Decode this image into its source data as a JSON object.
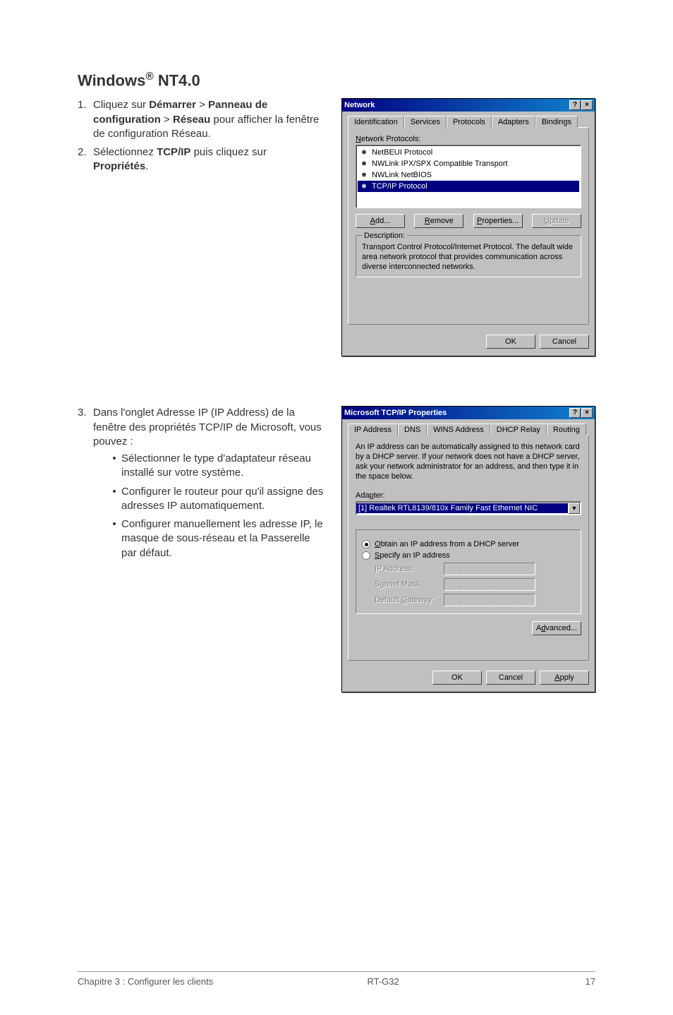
{
  "heading_plain": "Windows® NT4.0",
  "instructions_top": [
    {
      "num": "1.",
      "html": "Cliquez sur <b>Démarrer</b> > <b>Panneau de configuration</b> > <b>Réseau</b> pour afficher la fenêtre de configuration Réseau."
    },
    {
      "num": "2.",
      "html": "Sélectionnez <b>TCP/IP</b> puis cliquez sur <b>Propriétés</b>."
    }
  ],
  "instructions_bottom": [
    {
      "num": "3.",
      "html": "Dans l'onglet Adresse IP (IP Address) de la fenêtre des propriétés TCP/IP de Microsoft, vous pouvez :",
      "sub": [
        "Sélectionner le type d'adaptateur réseau installé sur votre système.",
        "Configurer le routeur pour qu'il assigne des adresses IP automatiquement.",
        "Configurer manuellement les adresse IP, le masque de sous-réseau et la Passerelle par défaut."
      ]
    }
  ],
  "dialog1": {
    "title": "Network",
    "tabs": [
      "Identification",
      "Services",
      "Protocols",
      "Adapters",
      "Bindings"
    ],
    "active_tab_index": 2,
    "list_label_html": "<span class='underline-char'>N</span>etwork Protocols:",
    "protocols": [
      {
        "label": "NetBEUI Protocol",
        "selected": false
      },
      {
        "label": "NWLink IPX/SPX Compatible Transport",
        "selected": false
      },
      {
        "label": "NWLink NetBIOS",
        "selected": false
      },
      {
        "label": "TCP/IP Protocol",
        "selected": true
      }
    ],
    "buttons": {
      "add_html": "<span class='underline-char'>A</span>dd...",
      "remove_html": "<span class='underline-char'>R</span>emove",
      "properties_html": "<span class='underline-char'>P</span>roperties...",
      "update_html": "<span class='underline-char'>U</span>pdate"
    },
    "desc_title": "Description:",
    "desc_text": "Transport Control Protocol/Internet Protocol. The default wide area network protocol that provides communication across diverse interconnected networks.",
    "ok": "OK",
    "cancel": "Cancel"
  },
  "dialog2": {
    "title": "Microsoft TCP/IP Properties",
    "tabs": [
      "IP Address",
      "DNS",
      "WINS Address",
      "DHCP Relay",
      "Routing"
    ],
    "active_tab_index": 0,
    "intro": "An IP address can be automatically assigned to this network card by a DHCP server. If your network does not have a DHCP server, ask your network administrator for an address, and then type it in the space below.",
    "adapter_label_html": "Ada<span class='underline-char'>p</span>ter:",
    "adapter_value": "[1] Realtek RTL8139/810x Family Fast Ethernet NIC",
    "radio_obtain_html": "<span class='underline-char'>O</span>btain an IP address from a DHCP server",
    "radio_specify_html": "<span class='underline-char'>S</span>pecify an IP address",
    "fields": {
      "ip_html": "<span class='underline-char'>I</span>P Address:",
      "subnet_html": "S<span class='underline-char'>u</span>bnet Mask:",
      "gateway_html": "Default <span class='underline-char'>G</span>ateway:"
    },
    "advanced_html": "A<span class='underline-char'>d</span>vanced...",
    "ok": "OK",
    "cancel": "Cancel",
    "apply_html": "<span class='underline-char'>A</span>pply"
  },
  "footer": {
    "left": "Chapitre 3 : Configurer les clients",
    "center": "RT-G32",
    "page": "17"
  }
}
